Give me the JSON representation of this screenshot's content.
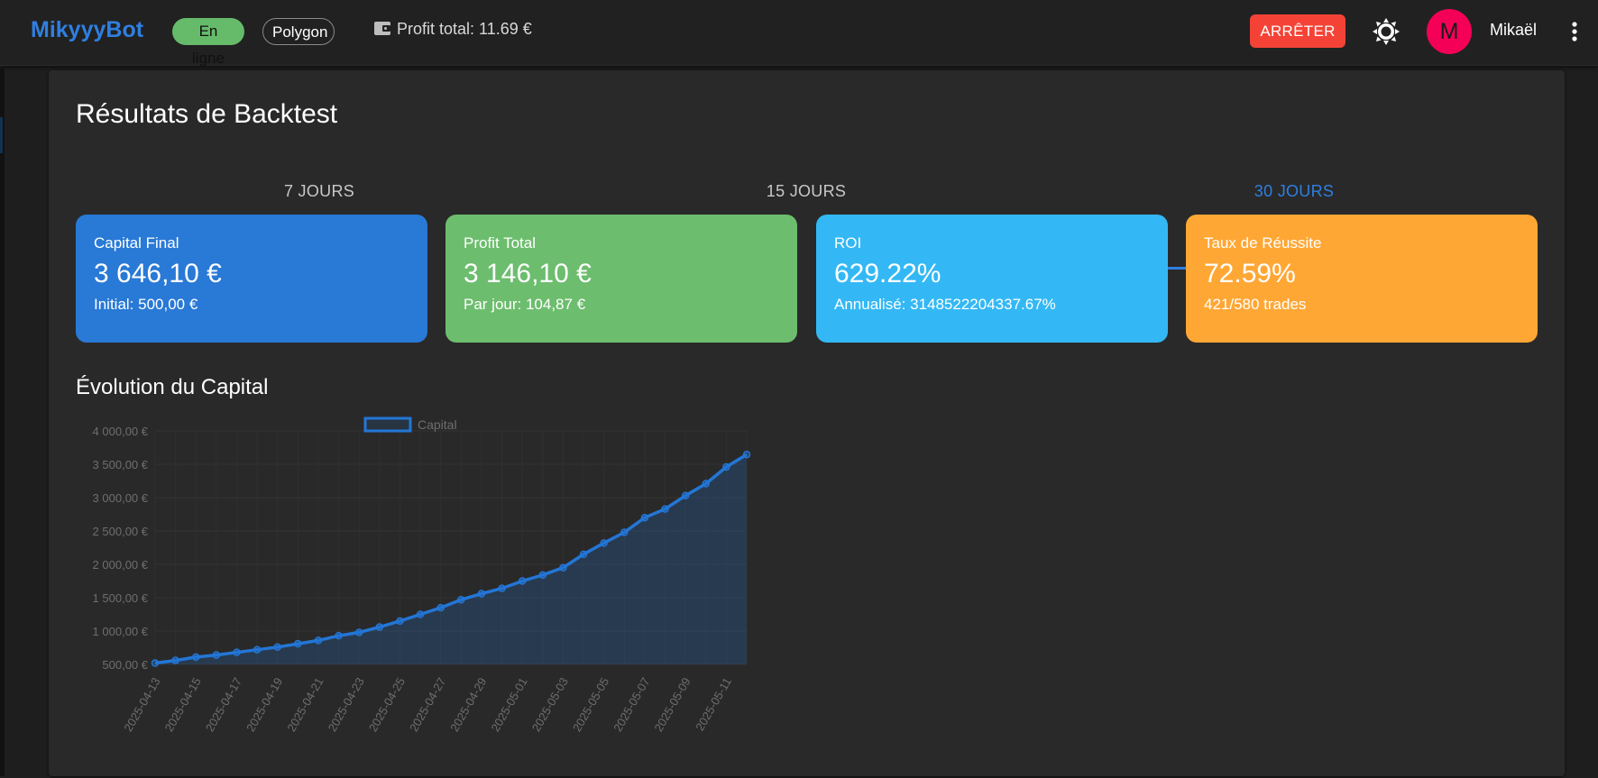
{
  "header": {
    "brand": "MikyyyBot",
    "status_chip": "En ligne",
    "network_chip": "Polygon",
    "profit_total": "Profit total: 11.69 €",
    "stop_button": "ARRÊTER",
    "avatar_letter": "M",
    "username": "Mikaël",
    "wallet_icon": "wallet-icon",
    "theme_icon": "brightness-icon",
    "more_icon": "more-vert-icon"
  },
  "main": {
    "title": "Résultats de Backtest",
    "tabs": [
      {
        "label": "7 JOURS",
        "active": false
      },
      {
        "label": "15 JOURS",
        "active": false
      },
      {
        "label": "30 JOURS",
        "active": true
      }
    ],
    "cards": [
      {
        "label": "Capital Final",
        "value": "3 646,10 €",
        "sub": "Initial: 500,00 €",
        "color": "#2979d6"
      },
      {
        "label": "Profit Total",
        "value": "3 146,10 €",
        "sub": "Par jour: 104,87 €",
        "color": "#6dbd6e"
      },
      {
        "label": "ROI",
        "value": "629.22%",
        "sub": "Annualisé: 3148522204337.67%",
        "color": "#33b8f5"
      },
      {
        "label": "Taux de Réussite",
        "value": "72.59%",
        "sub": "421/580 trades",
        "color": "#ffa734"
      }
    ],
    "section_title": "Évolution du Capital"
  },
  "colors": {
    "accent": "#2f7fe0",
    "online": "#66bb6a",
    "stop": "#f44336",
    "avatar": "#f50057",
    "series": "#2376d6"
  },
  "chart_data": {
    "type": "area",
    "legend": "top",
    "grid": true,
    "ylim": [
      500,
      4000
    ],
    "y_ticks": [
      "4 000,00 €",
      "3 500,00 €",
      "3 000,00 €",
      "2 500,00 €",
      "2 000,00 €",
      "1 500,00 €",
      "1 000,00 €",
      "500,00 €"
    ],
    "x": [
      "2025-04-13",
      "2025-04-14",
      "2025-04-15",
      "2025-04-16",
      "2025-04-17",
      "2025-04-18",
      "2025-04-19",
      "2025-04-20",
      "2025-04-21",
      "2025-04-22",
      "2025-04-23",
      "2025-04-24",
      "2025-04-25",
      "2025-04-26",
      "2025-04-27",
      "2025-04-28",
      "2025-04-29",
      "2025-04-30",
      "2025-05-01",
      "2025-05-02",
      "2025-05-03",
      "2025-05-04",
      "2025-05-05",
      "2025-05-06",
      "2025-05-07",
      "2025-05-08",
      "2025-05-09",
      "2025-05-10",
      "2025-05-11",
      "2025-05-12"
    ],
    "x_tick_labels": [
      "2025-04-13",
      "2025-04-15",
      "2025-04-17",
      "2025-04-19",
      "2025-04-21",
      "2025-04-23",
      "2025-04-25",
      "2025-04-27",
      "2025-04-29",
      "2025-05-01",
      "2025-05-03",
      "2025-05-05",
      "2025-05-07",
      "2025-05-09",
      "2025-05-11"
    ],
    "series": [
      {
        "name": "Capital",
        "values": [
          520,
          560,
          610,
          640,
          680,
          720,
          760,
          810,
          860,
          930,
          980,
          1060,
          1150,
          1250,
          1350,
          1470,
          1560,
          1640,
          1750,
          1840,
          1950,
          2150,
          2320,
          2480,
          2700,
          2830,
          3030,
          3210,
          3460,
          3646
        ]
      }
    ]
  }
}
